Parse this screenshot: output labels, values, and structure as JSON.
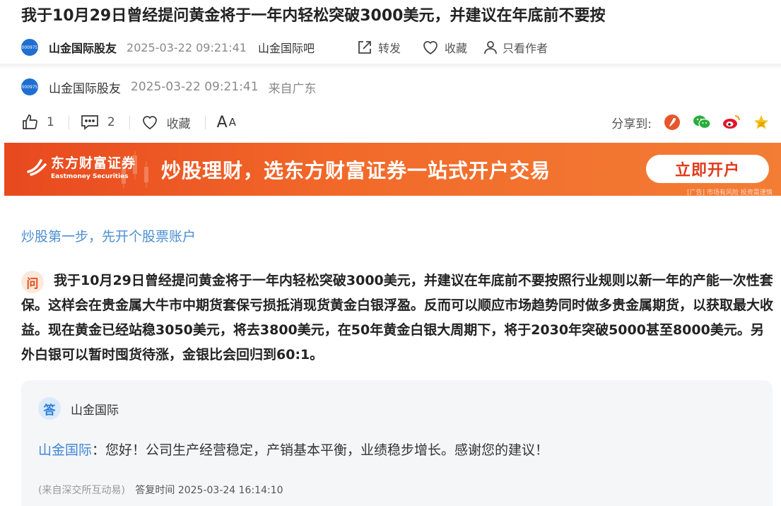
{
  "page": {
    "title": "我于10月29日曾经提问黄金将于一年内轻松突破3000美元，并建议在年底前不要按"
  },
  "header": {
    "avatar_text": "000975",
    "author": "山金国际股友",
    "time": "2025-03-22 09:21:41",
    "bar_name": "山金国际吧",
    "share_label": "转发",
    "favorite_label": "收藏",
    "only_author_label": "只看作者"
  },
  "post": {
    "avatar_text": "000975",
    "author": "山金国际股友",
    "time": "2025-03-22 09:21:41",
    "from": "来自广东"
  },
  "toolbar": {
    "like_count": "1",
    "comment_count": "2",
    "favorite_label": "收藏",
    "font_big": "A",
    "font_small": "A",
    "share_to_label": "分享到:",
    "share_icons": [
      "weibo-tencent-icon",
      "wechat-icon",
      "sina-weibo-icon",
      "qzone-star-icon"
    ]
  },
  "banner": {
    "logo_cn": "东方财富证券",
    "logo_en": "Eastmoney Securities",
    "slogan": "炒股理财，选东方财富证券一站式开户交易",
    "cta": "立即开户",
    "disclaimer": "[广告] 市场有风险 投资需谨慎",
    "colors": {
      "start": "#e8491f",
      "end": "#f37d35"
    }
  },
  "content": {
    "open_account_link": "炒股第一步，先开个股票账户",
    "question_badge": "问",
    "question_text": "我于10月29日曾经提问黄金将于一年内轻松突破3000美元，并建议在年底前不要按照行业规则以新一年的产能一次性套保。这样会在贵金属大牛市中期货套保亏损抵消现货黄金白银浮盈。反而可以顺应市场趋势同时做多贵金属期货，以获取最大收益。现在黄金已经站稳3050美元，将去3800美元，在50年黄金白银大周期下，将于2030年突破5000甚至8000美元。另外白银可以暂时囤货待涨，金银比会回归到60:1。"
  },
  "answer": {
    "badge": "答",
    "company": "山金国际",
    "who": "山金国际",
    "text": "：您好！公司生产经营稳定，产销基本平衡，业绩稳步增长。感谢您的建议！",
    "source": "(来自深交所互动易)",
    "reply_time": "答复时间 2025-03-24 16:14:10"
  }
}
